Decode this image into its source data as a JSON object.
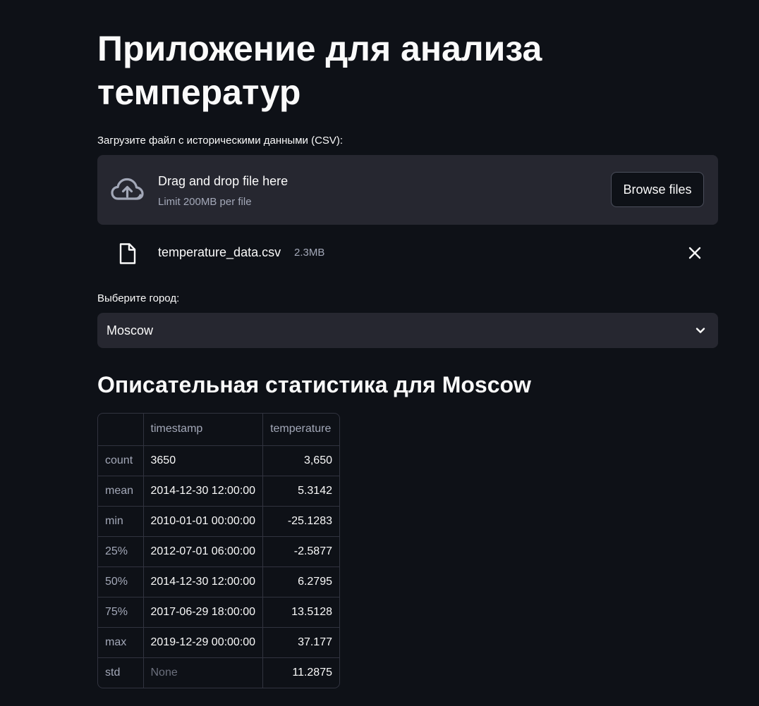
{
  "header": {
    "title": "Приложение для анализа температур"
  },
  "uploader": {
    "label": "Загрузите файл с историческими данными (CSV):",
    "drop_text": "Drag and drop file here",
    "limit_text": "Limit 200MB per file",
    "browse_label": "Browse files",
    "icon": "cloud-upload-icon"
  },
  "uploaded_file": {
    "name": "temperature_data.csv",
    "size": "2.3MB",
    "icon": "file-icon",
    "remove_icon": "close-icon"
  },
  "city_select": {
    "label": "Выберите город:",
    "value": "Moscow",
    "icon": "chevron-down-icon"
  },
  "stats": {
    "title": "Описательная статистика для Moscow",
    "columns": [
      "",
      "timestamp",
      "temperature"
    ],
    "rows": [
      {
        "index": "count",
        "timestamp": "3650",
        "temperature": "3,650"
      },
      {
        "index": "mean",
        "timestamp": "2014-12-30 12:00:00",
        "temperature": "5.3142"
      },
      {
        "index": "min",
        "timestamp": "2010-01-01 00:00:00",
        "temperature": "-25.1283"
      },
      {
        "index": "25%",
        "timestamp": "2012-07-01 06:00:00",
        "temperature": "-2.5877"
      },
      {
        "index": "50%",
        "timestamp": "2014-12-30 12:00:00",
        "temperature": "6.2795"
      },
      {
        "index": "75%",
        "timestamp": "2017-06-29 18:00:00",
        "temperature": "13.5128"
      },
      {
        "index": "max",
        "timestamp": "2019-12-29 00:00:00",
        "temperature": "37.177"
      },
      {
        "index": "std",
        "timestamp": "None",
        "temperature": "11.2875"
      }
    ]
  },
  "colors": {
    "background": "#0e1117",
    "surface": "#262730",
    "text": "#fafafa",
    "muted": "#a3a8b8",
    "border": "#31333f"
  }
}
